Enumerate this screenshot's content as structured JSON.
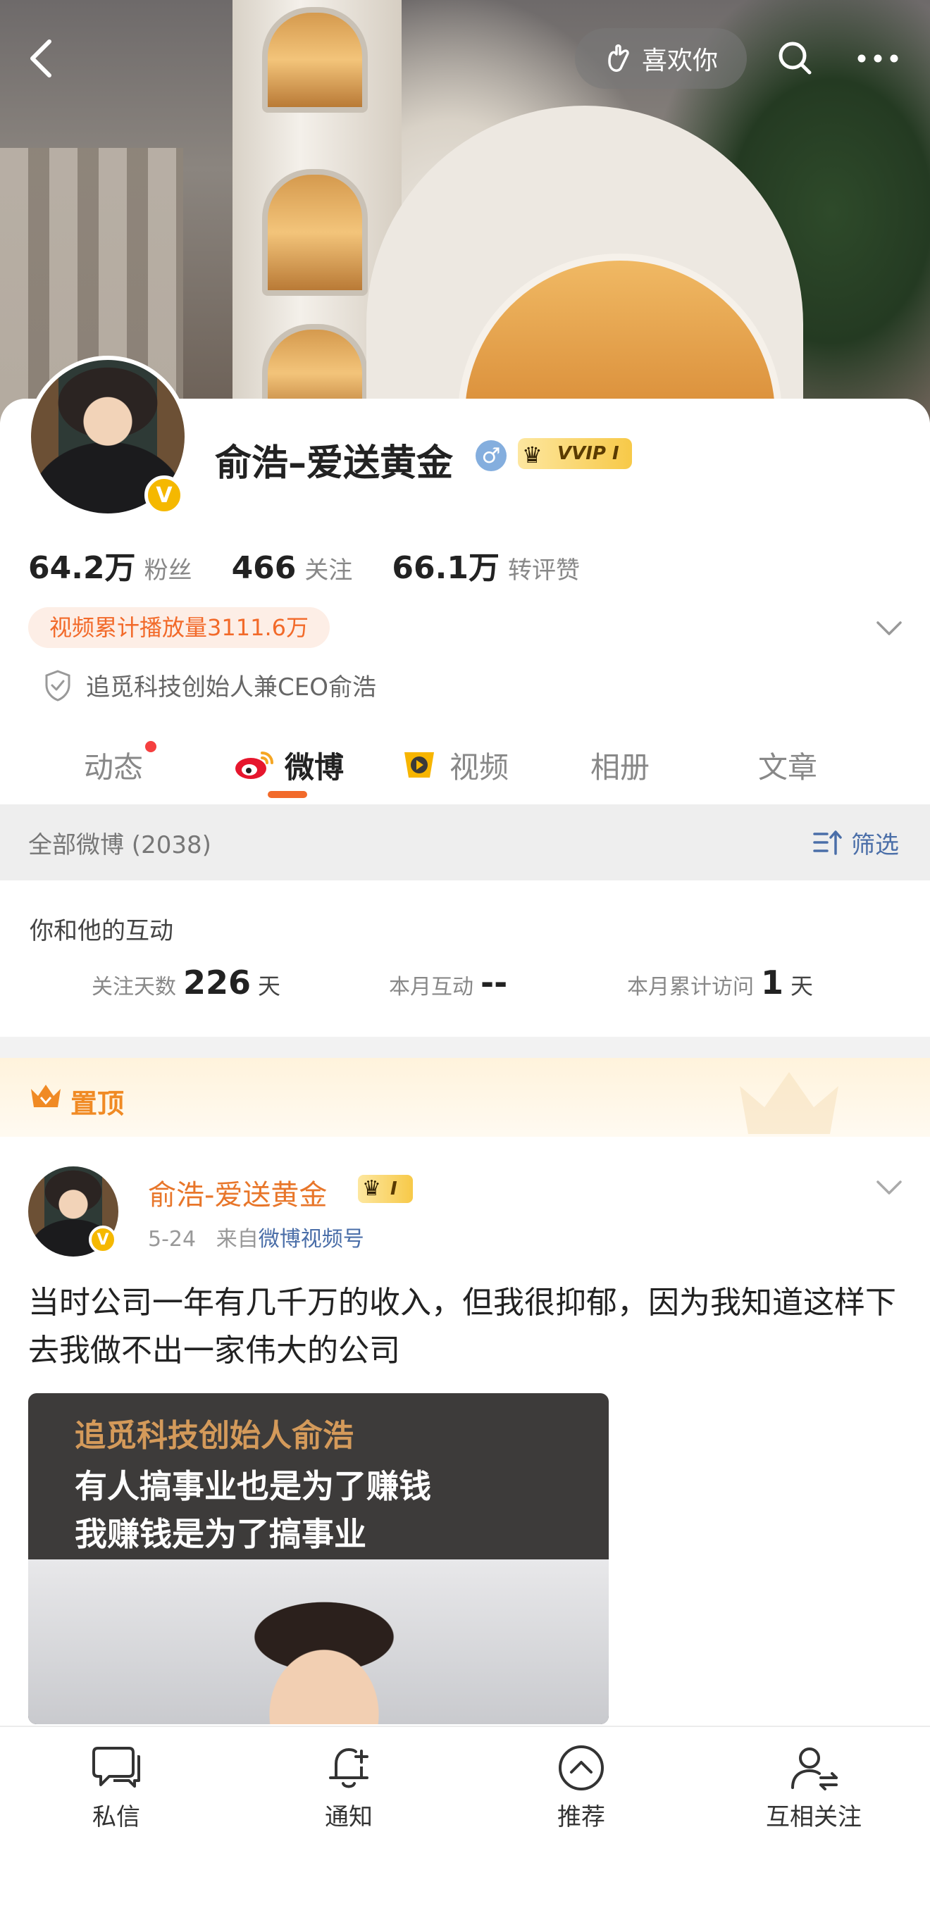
{
  "header": {
    "like_label": "喜欢你"
  },
  "profile": {
    "name": "俞浩–爱送黄金",
    "gender_symbol": "♂",
    "vip_badge": "VVIP I",
    "verified_badge": "V",
    "stats": [
      {
        "value": "64.2万",
        "label": "粉丝"
      },
      {
        "value": "466",
        "label": "关注"
      },
      {
        "value": "66.1万",
        "label": "转评赞"
      }
    ],
    "video_play_badge": "视频累计播放量3111.6万",
    "verification_text": "追觅科技创始人兼CEO俞浩"
  },
  "tabs": [
    {
      "label": "动态",
      "has_dot": true
    },
    {
      "label": "微博",
      "active": true
    },
    {
      "label": "视频"
    },
    {
      "label": "相册"
    },
    {
      "label": "文章"
    }
  ],
  "filter_bar": {
    "count_text": "全部微博 (2038)",
    "filter_label": "筛选"
  },
  "interaction": {
    "title": "你和他的互动",
    "items": [
      {
        "label": "关注天数",
        "value": "226",
        "unit": "天"
      },
      {
        "label": "本月互动",
        "value": "--",
        "unit": ""
      },
      {
        "label": "本月累计访问",
        "value": "1",
        "unit": "天"
      }
    ]
  },
  "pinned": {
    "label": "置顶"
  },
  "post": {
    "author": "俞浩-爱送黄金",
    "vip_badge": "I",
    "date": "5-24",
    "source_prefix": "来自",
    "source": "微博视频号",
    "text": "当时公司一年有几千万的收入，但我很抑郁，因为我知道这样下去我做不出一家伟大的公司",
    "media_caption_title": "追觅科技创始人俞浩",
    "media_caption_line1": "有人搞事业也是为了赚钱",
    "media_caption_line2": "我赚钱是为了搞事业"
  },
  "bottom_bar": [
    {
      "label": "私信",
      "icon": "message-icon"
    },
    {
      "label": "通知",
      "icon": "bell-plus-icon"
    },
    {
      "label": "推荐",
      "icon": "chevron-up-circle-icon"
    },
    {
      "label": "互相关注",
      "icon": "user-exchange-icon"
    }
  ],
  "colors": {
    "accent_orange": "#f26a2a",
    "link_blue": "#4a6ea8",
    "vip_gold": "#f7c948"
  }
}
